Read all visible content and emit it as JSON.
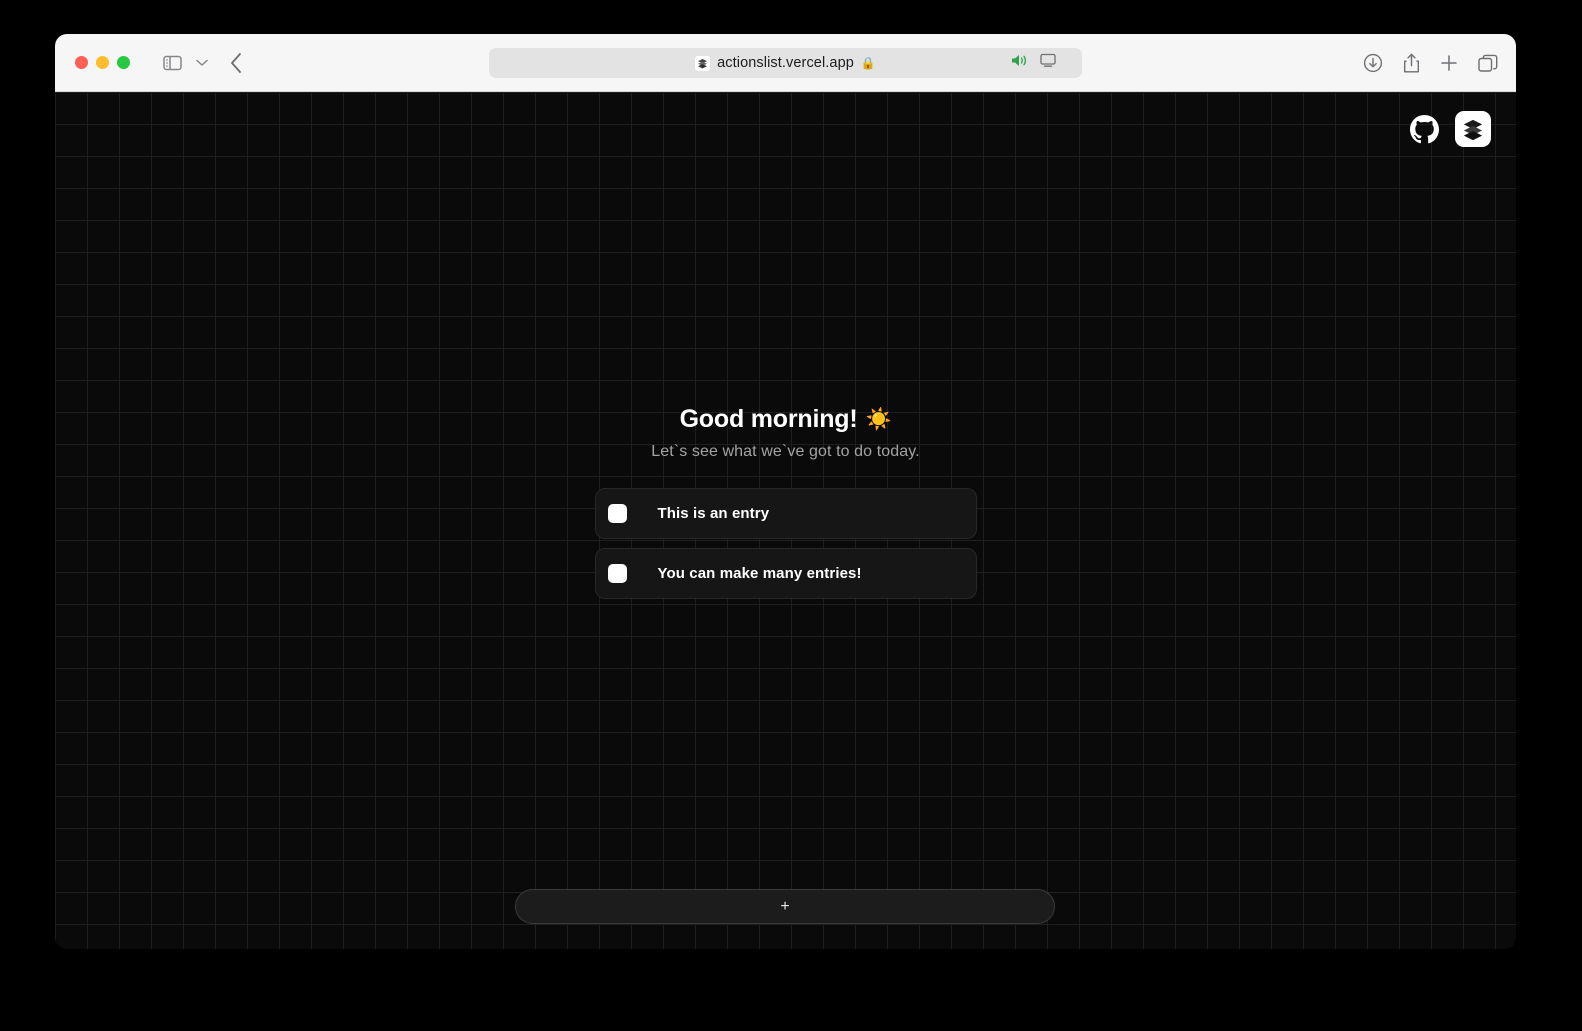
{
  "browser": {
    "traffic_lights": [
      {
        "name": "close",
        "color": "#ff5f57"
      },
      {
        "name": "minimize",
        "color": "#febc2e"
      },
      {
        "name": "maximize",
        "color": "#28c840"
      }
    ],
    "sidebar_toggle_icon": "sidebar-icon",
    "sidebar_dropdown_icon": "chevron-down-icon",
    "back_icon": "chevron-left-icon",
    "url": "actionslist.vercel.app",
    "url_lock": "🔒",
    "favicon_icon": "layers-stack-icon",
    "audio_icon": "speaker-playing-icon",
    "audio_color": "#30a14e",
    "screen_share_icon": "screen-mirror-icon",
    "toolbar_right_icons": [
      "download-icon",
      "share-icon",
      "new-tab-icon",
      "tab-overview-icon"
    ]
  },
  "app": {
    "header_actions": {
      "github_label": "github-icon",
      "layers_label": "layers-stack-icon"
    },
    "greeting": {
      "title": "Good morning!",
      "emoji": "☀️",
      "subtitle": "Let`s see what we`ve got to do today."
    },
    "tasks": [
      {
        "label": "This is an entry",
        "checked": false
      },
      {
        "label": "You can make many entries!",
        "checked": false
      }
    ],
    "add_button": {
      "label": "+",
      "icon": "plus-icon"
    },
    "colors": {
      "background": "#0a0a0a",
      "grid_line": "#1f1f1f",
      "card": "#161616",
      "card_border": "#272727",
      "text_primary": "#ffffff",
      "text_secondary": "#a3a3a3",
      "accent": "#ffffff"
    }
  }
}
